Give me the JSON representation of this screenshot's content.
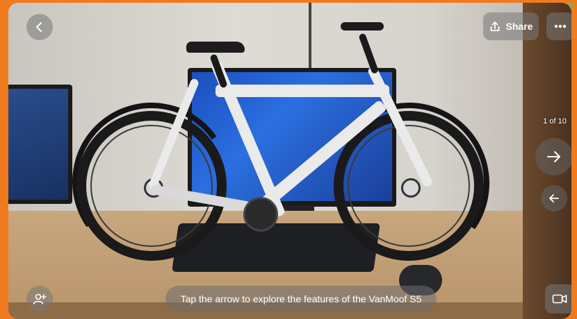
{
  "toolbar": {
    "share_label": "Share"
  },
  "gallery": {
    "counter": "1 of 10"
  },
  "caption": {
    "text": "Tap the arrow to explore the features of the VanMoof S5"
  },
  "icons": {
    "back": "chevron-left-icon",
    "share": "share-icon",
    "more": "more-horizontal-icon",
    "next": "arrow-right-icon",
    "prev": "arrow-left-icon",
    "invite": "add-person-icon",
    "camera": "video-camera-icon"
  },
  "colors": {
    "frame_border": "#f07a1e",
    "overlay_button": "#787878",
    "status": "#3ccf5a"
  }
}
